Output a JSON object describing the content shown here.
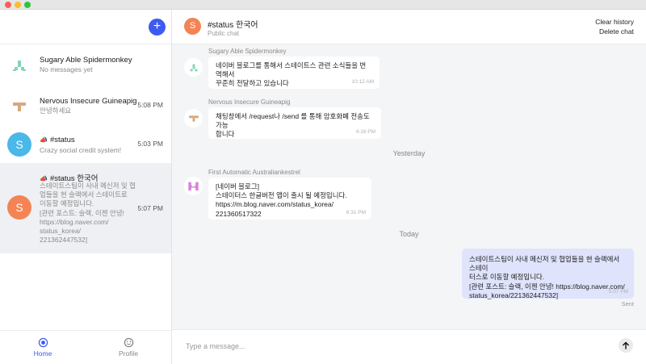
{
  "window": {
    "title": ""
  },
  "sidebar": {
    "new_chat_label": "+",
    "conversations": [
      {
        "name": "Sugary Able Spidermonkey",
        "preview": "No messages yet",
        "time": ""
      },
      {
        "name": "Nervous Insecure Guineapig",
        "preview": "안녕하세요",
        "time": "5:08 PM"
      },
      {
        "name": "#status",
        "preview": "Crazy social credit system!",
        "time": "5:03 PM",
        "avatar_letter": "S"
      },
      {
        "name": "#status 한국어",
        "preview_lines": [
          "스테이트스팀이 사내 메신저 및 협",
          "업들을 현 슬랙에서 스테이트로",
          "이동할 예정입니다.",
          "[관련 포스트: 슬랙, 이젠 안녕!",
          "https://blog.naver.com/",
          "status_korea/",
          "221362447532]"
        ],
        "time": "5:07 PM",
        "avatar_letter": "S"
      }
    ],
    "nav": {
      "home_label": "Home",
      "profile_label": "Profile"
    }
  },
  "chat": {
    "avatar_letter": "S",
    "title": "#status 한국어",
    "subtitle": "Public chat",
    "actions": {
      "clear_history": "Clear history",
      "delete_chat": "Delete chat"
    },
    "messages": [
      {
        "sender": "Sugary Able Spidermonkey",
        "lines": [
          "네이버 블로그를 통해서 스테이트스 관련 소식들을 번역해서",
          "꾸준히 전달하고 있습니다"
        ],
        "time": "10:12 AM"
      },
      {
        "sender": "Nervous Insecure Guineapig",
        "lines": [
          "채팅창에서 /request나 /send 를 통해 암호화폐 전송도 가능",
          "합니다"
        ],
        "time": "4:16 PM"
      },
      {
        "separator": "Yesterday"
      },
      {
        "sender": "First Automatic Australiankestrel",
        "lines": [
          "[네이버 블로그]",
          "스테이터스 한글버전 앱이 출시 될 예정입니다.",
          "https://m.blog.naver.com/status_korea/",
          "221360517322"
        ],
        "time": "6:31 PM"
      },
      {
        "separator": "Today"
      },
      {
        "sender": "",
        "lines": [
          "스테이트스팀이 사내 메신저 및 협업들을 현 슬랙에서 스테이",
          "터스로 이동할 예정입니다.",
          "[관련 포스트: 슬랙, 이젠 안녕! https://blog.naver.com/",
          "status_korea/221362447532]"
        ],
        "time": "5:07 PM",
        "status": "Sent"
      }
    ]
  },
  "composer": {
    "placeholder": "Type a message..."
  },
  "colors": {
    "accent": "#3d5af1",
    "status_avatar": "#4ab8e8",
    "korean_avatar": "#f48454",
    "outgoing_bubble": "#dfe3fb",
    "background": "#f4f5f7"
  },
  "icons": {
    "new_chat": "plus-icon",
    "home": "home-icon",
    "profile": "smiley-icon",
    "send": "arrow-up-icon",
    "channel": "megaphone-icon"
  }
}
